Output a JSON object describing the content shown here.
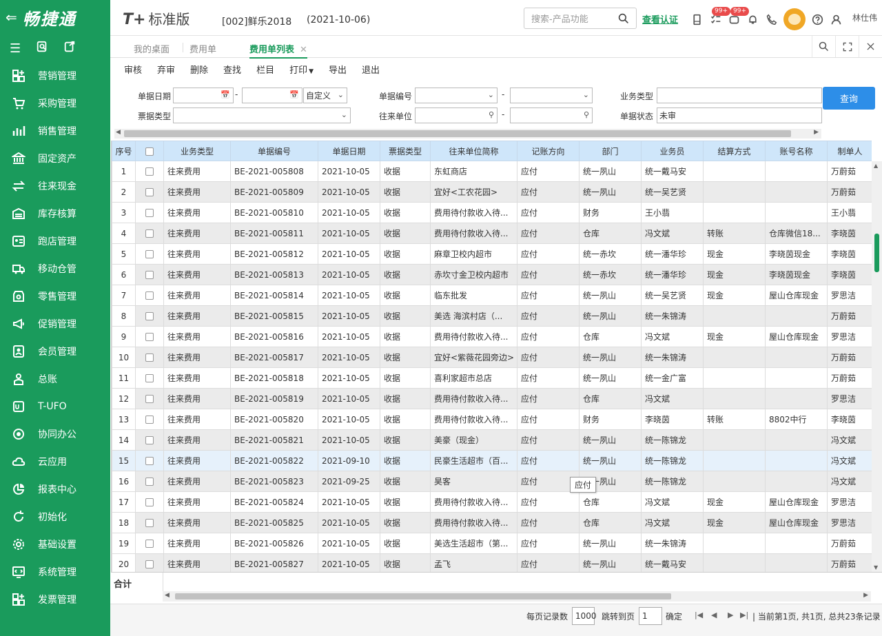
{
  "sidebar": {
    "logo": "畅捷通",
    "items": [
      {
        "label": "营销管理",
        "icon": "grid-plus-icon"
      },
      {
        "label": "采购管理",
        "icon": "cart-icon"
      },
      {
        "label": "销售管理",
        "icon": "bar-chart-icon"
      },
      {
        "label": "固定资产",
        "icon": "bank-icon"
      },
      {
        "label": "往来现金",
        "icon": "exchange-icon"
      },
      {
        "label": "库存核算",
        "icon": "warehouse-icon"
      },
      {
        "label": "跑店管理",
        "icon": "id-card-icon"
      },
      {
        "label": "移动仓管",
        "icon": "truck-icon"
      },
      {
        "label": "零售管理",
        "icon": "shop-icon"
      },
      {
        "label": "促销管理",
        "icon": "megaphone-icon"
      },
      {
        "label": "会员管理",
        "icon": "member-icon"
      },
      {
        "label": "总账",
        "icon": "ledger-icon"
      },
      {
        "label": "T-UFO",
        "icon": "ufo-icon"
      },
      {
        "label": "协同办公",
        "icon": "collab-icon"
      },
      {
        "label": "云应用",
        "icon": "cloud-icon"
      },
      {
        "label": "报表中心",
        "icon": "pie-chart-icon"
      },
      {
        "label": "初始化",
        "icon": "refresh-icon"
      },
      {
        "label": "基础设置",
        "icon": "settings-icon"
      },
      {
        "label": "系统管理",
        "icon": "system-icon"
      },
      {
        "label": "发票管理",
        "icon": "invoice-icon"
      }
    ]
  },
  "header": {
    "brand": "T+",
    "brand_sub": "标准版",
    "company": "[002]鲜乐2018",
    "date": "(2021-10-06)",
    "search_placeholder": "搜索-产品功能",
    "check_auth": "查看认证",
    "badge1": "99+",
    "badge2": "99+",
    "user": "林仕伟"
  },
  "tabs": {
    "t1": "我的桌面",
    "t2": "费用单",
    "t3": "费用单列表",
    "close": "✕"
  },
  "toolbar": [
    "审核",
    "弃审",
    "删除",
    "查找",
    "栏目",
    "打印",
    "导出",
    "退出"
  ],
  "filters": {
    "date_label": "单据日期",
    "dash": "-",
    "date_mode": "自定义",
    "code_label": "单据编号",
    "biz_label": "业务类型",
    "bill_label": "票据类型",
    "partner_label": "往来单位",
    "status_label": "单据状态",
    "status_value": "未审",
    "query": "查询"
  },
  "grid": {
    "headers": [
      "序号",
      "",
      "业务类型",
      "单据编号",
      "单据日期",
      "票据类型",
      "往来单位简称",
      "记账方向",
      "部门",
      "业务员",
      "结算方式",
      "账号名称",
      "制单人"
    ],
    "rows": [
      [
        "1",
        "往来费用",
        "BE-2021-005808",
        "2021-10-05",
        "收据",
        "东虹商店",
        "应付",
        "统一夙山",
        "统一戴马安",
        "",
        "",
        "万蔚茹"
      ],
      [
        "2",
        "往来费用",
        "BE-2021-005809",
        "2021-10-05",
        "收据",
        "宜好<工农花园>",
        "应付",
        "统一夙山",
        "统一吴艺贤",
        "",
        "",
        "万蔚茹"
      ],
      [
        "3",
        "往来费用",
        "BE-2021-005810",
        "2021-10-05",
        "收据",
        "费用待付款收入待...",
        "应付",
        "财务",
        "王小翡",
        "",
        "",
        "王小翡"
      ],
      [
        "4",
        "往来费用",
        "BE-2021-005811",
        "2021-10-05",
        "收据",
        "费用待付款收入待...",
        "应付",
        "仓库",
        "冯文斌",
        "转账",
        "仓库微信18...",
        "李晓茵"
      ],
      [
        "5",
        "往来费用",
        "BE-2021-005812",
        "2021-10-05",
        "收据",
        "麻章卫校内超市",
        "应付",
        "统一赤坎",
        "统一潘华珍",
        "现金",
        "李晓茵现金",
        "李晓茵"
      ],
      [
        "6",
        "往来费用",
        "BE-2021-005813",
        "2021-10-05",
        "收据",
        "赤坎寸金卫校内超市",
        "应付",
        "统一赤坎",
        "统一潘华珍",
        "现金",
        "李晓茵现金",
        "李晓茵"
      ],
      [
        "7",
        "往来费用",
        "BE-2021-005814",
        "2021-10-05",
        "收据",
        "临东批发",
        "应付",
        "统一夙山",
        "统一吴艺贤",
        "现金",
        "屋山仓库现金",
        "罗思洁"
      ],
      [
        "8",
        "往来费用",
        "BE-2021-005815",
        "2021-10-05",
        "收据",
        "美选 海滨村店（...",
        "应付",
        "统一夙山",
        "统一朱锦涛",
        "",
        "",
        "万蔚茹"
      ],
      [
        "9",
        "往来费用",
        "BE-2021-005816",
        "2021-10-05",
        "收据",
        "费用待付款收入待...",
        "应付",
        "仓库",
        "冯文斌",
        "现金",
        "屋山仓库现金",
        "罗思洁"
      ],
      [
        "10",
        "往来费用",
        "BE-2021-005817",
        "2021-10-05",
        "收据",
        "宜好<紫薇花园旁边>",
        "应付",
        "统一夙山",
        "统一朱锦涛",
        "",
        "",
        "万蔚茹"
      ],
      [
        "11",
        "往来费用",
        "BE-2021-005818",
        "2021-10-05",
        "收据",
        "喜利家超市总店",
        "应付",
        "统一夙山",
        "统一金广富",
        "",
        "",
        "万蔚茹"
      ],
      [
        "12",
        "往来费用",
        "BE-2021-005819",
        "2021-10-05",
        "收据",
        "费用待付款收入待...",
        "应付",
        "仓库",
        "冯文斌",
        "",
        "",
        "罗思洁"
      ],
      [
        "13",
        "往来费用",
        "BE-2021-005820",
        "2021-10-05",
        "收据",
        "费用待付款收入待...",
        "应付",
        "财务",
        "李晓茵",
        "转账",
        "8802中行",
        "李晓茵"
      ],
      [
        "14",
        "往来费用",
        "BE-2021-005821",
        "2021-10-05",
        "收据",
        "美豪（现金）",
        "应付",
        "统一夙山",
        "统一陈锦龙",
        "",
        "",
        "冯文斌"
      ],
      [
        "15",
        "往来费用",
        "BE-2021-005822",
        "2021-09-10",
        "收据",
        "民豪生活超市（百...",
        "应付",
        "统一夙山",
        "统一陈锦龙",
        "",
        "",
        "冯文斌"
      ],
      [
        "16",
        "往来费用",
        "BE-2021-005823",
        "2021-09-25",
        "收据",
        "昊客",
        "应付",
        "统一夙山",
        "统一陈锦龙",
        "",
        "",
        "冯文斌"
      ],
      [
        "17",
        "往来费用",
        "BE-2021-005824",
        "2021-10-05",
        "收据",
        "费用待付款收入待...",
        "应付",
        "仓库",
        "冯文斌",
        "现金",
        "屋山仓库现金",
        "罗思洁"
      ],
      [
        "18",
        "往来费用",
        "BE-2021-005825",
        "2021-10-05",
        "收据",
        "费用待付款收入待...",
        "应付",
        "仓库",
        "冯文斌",
        "现金",
        "屋山仓库现金",
        "罗思洁"
      ],
      [
        "19",
        "往来费用",
        "BE-2021-005826",
        "2021-10-05",
        "收据",
        "美选生活超市（第...",
        "应付",
        "统一夙山",
        "统一朱锦涛",
        "",
        "",
        "万蔚茹"
      ],
      [
        "20",
        "往来费用",
        "BE-2021-005827",
        "2021-10-05",
        "收据",
        "孟飞",
        "应付",
        "统一夙山",
        "统一戴马安",
        "",
        "",
        "万蔚茹"
      ]
    ],
    "sum_label": "合计",
    "tooltip": "应付"
  },
  "pager": {
    "per_page_label": "每页记录数",
    "per_page": "1000",
    "goto_label": "跳转到页",
    "goto_value": "1",
    "confirm": "确定",
    "info": "当前第1页, 共1页, 总共23条记录"
  }
}
